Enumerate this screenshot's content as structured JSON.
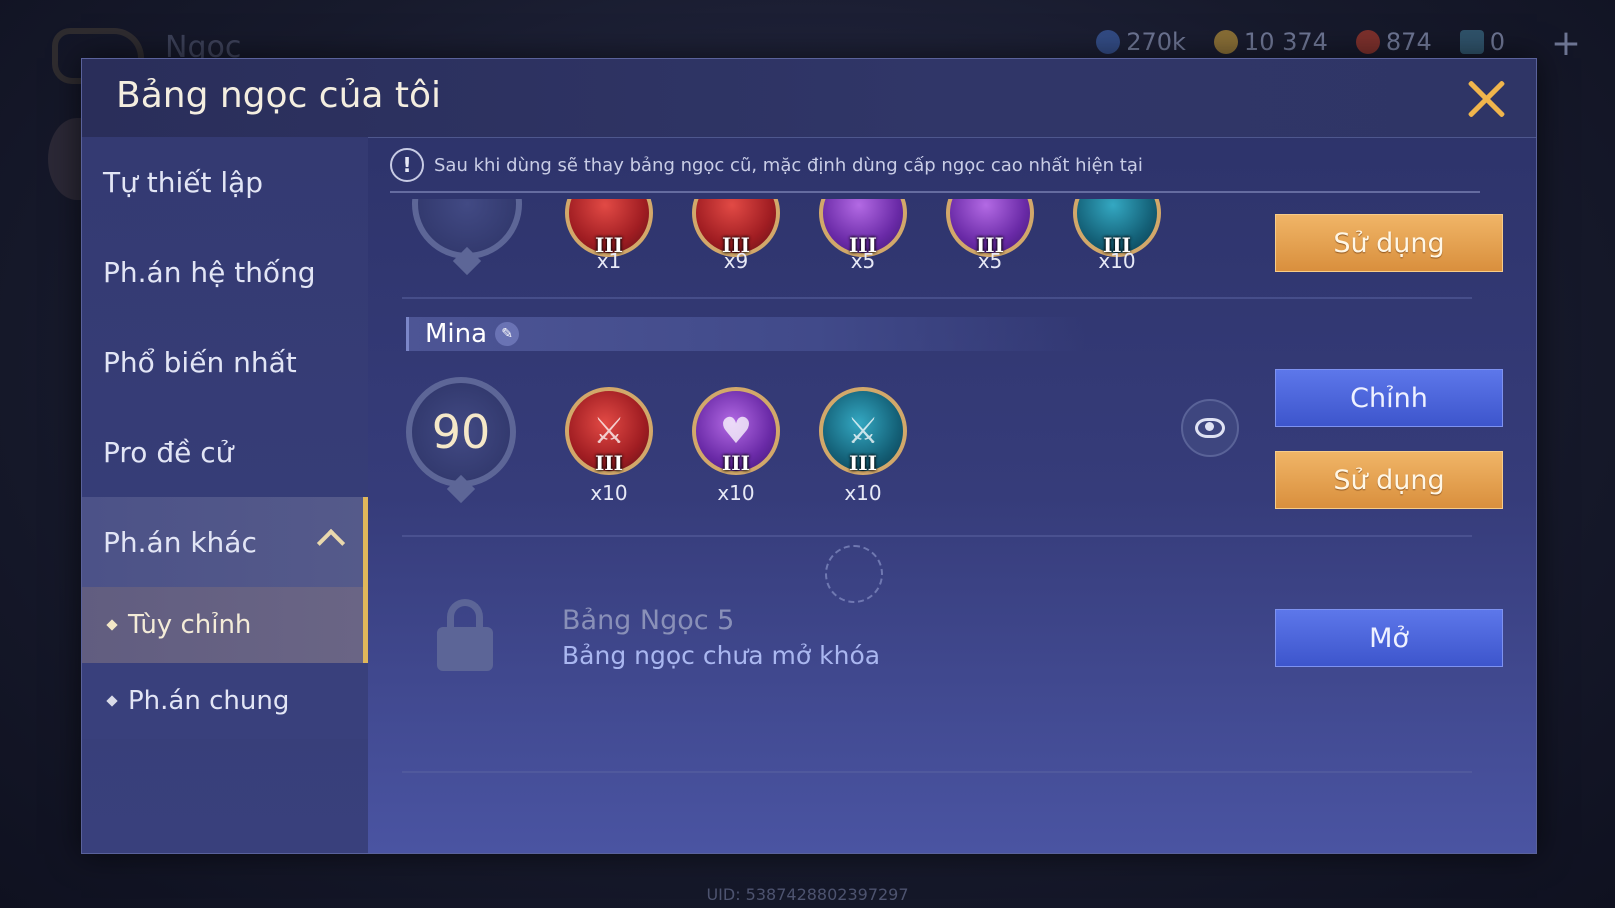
{
  "background": {
    "title": "Ngọc",
    "currencies": [
      {
        "icon": "blue-gem-icon",
        "value": "270k"
      },
      {
        "icon": "gold-coin-icon",
        "value": "10 374"
      },
      {
        "icon": "red-voucher-icon",
        "value": "874"
      },
      {
        "icon": "card-icon",
        "value": "0"
      }
    ],
    "uid": "UID: 5387428802397297"
  },
  "modal": {
    "title": "Bảng ngọc của tôi",
    "notice": "Sau khi dùng sẽ thay bảng ngọc cũ, mặc định dùng cấp ngọc cao nhất hiện tại"
  },
  "sidebar": {
    "items": [
      {
        "label": "Tự thiết lập"
      },
      {
        "label": "Ph.án hệ thống"
      },
      {
        "label": "Phổ biến nhất"
      },
      {
        "label": "Pro đề cử"
      },
      {
        "label": "Ph.án khác"
      }
    ],
    "subitems": [
      {
        "label": "Tùy chỉnh"
      },
      {
        "label": "Ph.án chung"
      }
    ]
  },
  "loadouts": [
    {
      "name": "",
      "gems": [
        {
          "color": "red",
          "tier": "III",
          "count": "x1"
        },
        {
          "color": "red",
          "tier": "III",
          "count": "x9"
        },
        {
          "color": "purple",
          "tier": "III",
          "count": "x5"
        },
        {
          "color": "purple",
          "tier": "III",
          "count": "x5"
        },
        {
          "color": "teal",
          "tier": "III",
          "count": "x10"
        }
      ],
      "use_label": "Sử dụng"
    },
    {
      "name": "Mina",
      "level": "90",
      "gems": [
        {
          "color": "red",
          "tier": "III",
          "count": "x10"
        },
        {
          "color": "purple",
          "tier": "III",
          "count": "x10"
        },
        {
          "color": "teal",
          "tier": "III",
          "count": "x10"
        }
      ],
      "edit_label": "Chỉnh",
      "use_label": "Sử dụng"
    }
  ],
  "locked": {
    "title": "Bảng Ngọc 5",
    "subtitle": "Bảng ngọc chưa mở khóa",
    "open_label": "Mở"
  },
  "colors": {
    "accent_gold": "#e0b75a",
    "button_gold": "#e6a14f",
    "button_blue": "#4a64da"
  }
}
